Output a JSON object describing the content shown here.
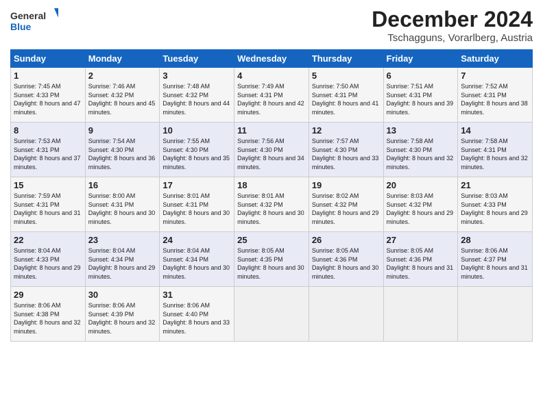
{
  "header": {
    "logo": {
      "general": "General",
      "blue": "Blue"
    },
    "title": "December 2024",
    "subtitle": "Tschagguns, Vorarlberg, Austria"
  },
  "calendar": {
    "days_of_week": [
      "Sunday",
      "Monday",
      "Tuesday",
      "Wednesday",
      "Thursday",
      "Friday",
      "Saturday"
    ],
    "weeks": [
      [
        null,
        null,
        null,
        null,
        null,
        null,
        null
      ]
    ],
    "cells": [
      {
        "day": 1,
        "col": 0,
        "sunrise": "7:45 AM",
        "sunset": "4:33 PM",
        "daylight": "8 hours and 47 minutes."
      },
      {
        "day": 2,
        "col": 1,
        "sunrise": "7:46 AM",
        "sunset": "4:32 PM",
        "daylight": "8 hours and 45 minutes."
      },
      {
        "day": 3,
        "col": 2,
        "sunrise": "7:48 AM",
        "sunset": "4:32 PM",
        "daylight": "8 hours and 44 minutes."
      },
      {
        "day": 4,
        "col": 3,
        "sunrise": "7:49 AM",
        "sunset": "4:31 PM",
        "daylight": "8 hours and 42 minutes."
      },
      {
        "day": 5,
        "col": 4,
        "sunrise": "7:50 AM",
        "sunset": "4:31 PM",
        "daylight": "8 hours and 41 minutes."
      },
      {
        "day": 6,
        "col": 5,
        "sunrise": "7:51 AM",
        "sunset": "4:31 PM",
        "daylight": "8 hours and 39 minutes."
      },
      {
        "day": 7,
        "col": 6,
        "sunrise": "7:52 AM",
        "sunset": "4:31 PM",
        "daylight": "8 hours and 38 minutes."
      },
      {
        "day": 8,
        "col": 0,
        "sunrise": "7:53 AM",
        "sunset": "4:31 PM",
        "daylight": "8 hours and 37 minutes."
      },
      {
        "day": 9,
        "col": 1,
        "sunrise": "7:54 AM",
        "sunset": "4:30 PM",
        "daylight": "8 hours and 36 minutes."
      },
      {
        "day": 10,
        "col": 2,
        "sunrise": "7:55 AM",
        "sunset": "4:30 PM",
        "daylight": "8 hours and 35 minutes."
      },
      {
        "day": 11,
        "col": 3,
        "sunrise": "7:56 AM",
        "sunset": "4:30 PM",
        "daylight": "8 hours and 34 minutes."
      },
      {
        "day": 12,
        "col": 4,
        "sunrise": "7:57 AM",
        "sunset": "4:30 PM",
        "daylight": "8 hours and 33 minutes."
      },
      {
        "day": 13,
        "col": 5,
        "sunrise": "7:58 AM",
        "sunset": "4:30 PM",
        "daylight": "8 hours and 32 minutes."
      },
      {
        "day": 14,
        "col": 6,
        "sunrise": "7:58 AM",
        "sunset": "4:31 PM",
        "daylight": "8 hours and 32 minutes."
      },
      {
        "day": 15,
        "col": 0,
        "sunrise": "7:59 AM",
        "sunset": "4:31 PM",
        "daylight": "8 hours and 31 minutes."
      },
      {
        "day": 16,
        "col": 1,
        "sunrise": "8:00 AM",
        "sunset": "4:31 PM",
        "daylight": "8 hours and 30 minutes."
      },
      {
        "day": 17,
        "col": 2,
        "sunrise": "8:01 AM",
        "sunset": "4:31 PM",
        "daylight": "8 hours and 30 minutes."
      },
      {
        "day": 18,
        "col": 3,
        "sunrise": "8:01 AM",
        "sunset": "4:32 PM",
        "daylight": "8 hours and 30 minutes."
      },
      {
        "day": 19,
        "col": 4,
        "sunrise": "8:02 AM",
        "sunset": "4:32 PM",
        "daylight": "8 hours and 29 minutes."
      },
      {
        "day": 20,
        "col": 5,
        "sunrise": "8:03 AM",
        "sunset": "4:32 PM",
        "daylight": "8 hours and 29 minutes."
      },
      {
        "day": 21,
        "col": 6,
        "sunrise": "8:03 AM",
        "sunset": "4:33 PM",
        "daylight": "8 hours and 29 minutes."
      },
      {
        "day": 22,
        "col": 0,
        "sunrise": "8:04 AM",
        "sunset": "4:33 PM",
        "daylight": "8 hours and 29 minutes."
      },
      {
        "day": 23,
        "col": 1,
        "sunrise": "8:04 AM",
        "sunset": "4:34 PM",
        "daylight": "8 hours and 29 minutes."
      },
      {
        "day": 24,
        "col": 2,
        "sunrise": "8:04 AM",
        "sunset": "4:34 PM",
        "daylight": "8 hours and 30 minutes."
      },
      {
        "day": 25,
        "col": 3,
        "sunrise": "8:05 AM",
        "sunset": "4:35 PM",
        "daylight": "8 hours and 30 minutes."
      },
      {
        "day": 26,
        "col": 4,
        "sunrise": "8:05 AM",
        "sunset": "4:36 PM",
        "daylight": "8 hours and 30 minutes."
      },
      {
        "day": 27,
        "col": 5,
        "sunrise": "8:05 AM",
        "sunset": "4:36 PM",
        "daylight": "8 hours and 31 minutes."
      },
      {
        "day": 28,
        "col": 6,
        "sunrise": "8:06 AM",
        "sunset": "4:37 PM",
        "daylight": "8 hours and 31 minutes."
      },
      {
        "day": 29,
        "col": 0,
        "sunrise": "8:06 AM",
        "sunset": "4:38 PM",
        "daylight": "8 hours and 32 minutes."
      },
      {
        "day": 30,
        "col": 1,
        "sunrise": "8:06 AM",
        "sunset": "4:39 PM",
        "daylight": "8 hours and 32 minutes."
      },
      {
        "day": 31,
        "col": 2,
        "sunrise": "8:06 AM",
        "sunset": "4:40 PM",
        "daylight": "8 hours and 33 minutes."
      }
    ]
  }
}
